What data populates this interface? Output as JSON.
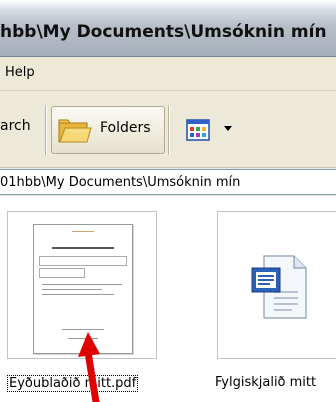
{
  "window": {
    "title": "hbb\\My Documents\\Umsóknin mín"
  },
  "menubar": {
    "items": [
      "Help"
    ]
  },
  "toolbar": {
    "search_label": "arch",
    "folders_label": "Folders"
  },
  "address": {
    "path": "01hbb\\My Documents\\Umsóknin mín"
  },
  "files": [
    {
      "name": "Eyðublaðið mitt.pdf",
      "type": "pdf",
      "selected": true
    },
    {
      "name": "Fylgiskjalið mitt",
      "type": "word",
      "selected": false
    }
  ],
  "colors": {
    "selection_arrow": "#e00000",
    "titlebar": "#b7bec8",
    "toolbar_bg": "#ece9d8"
  }
}
